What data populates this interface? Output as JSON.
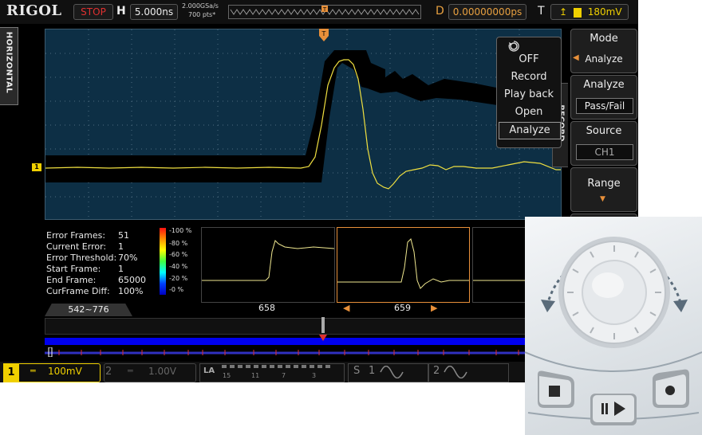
{
  "topbar": {
    "brand": "RIGOL",
    "run_state": "STOP",
    "h_label": "H",
    "timebase": "5.000ns",
    "sample_rate": "2.000GSa/s",
    "memory_depth": "700  pts*",
    "d_label": "D",
    "delay": "0.00000000ps",
    "t_label": "T",
    "trigger_level": "180mV"
  },
  "side_tab": "HORIZONTAL",
  "ch1_marker": "1",
  "record_tab": "RECORD",
  "popup": {
    "items": [
      "OFF",
      "Record",
      "Play back",
      "Open",
      "Analyze"
    ],
    "selected": "Analyze"
  },
  "softkeys": {
    "mode_title": "Mode",
    "mode_value": "Analyze",
    "analyze_title": "Analyze",
    "analyze_value": "Pass/Fail",
    "source_title": "Source",
    "source_value": "CH1",
    "range_title": "Range"
  },
  "stats": [
    {
      "label": "Error Frames:",
      "value": "51"
    },
    {
      "label": "Current Error:",
      "value": "1"
    },
    {
      "label": "Error Threshold:",
      "value": "70%"
    },
    {
      "label": "Start Frame:",
      "value": "1"
    },
    {
      "label": "End Frame:",
      "value": "65000"
    },
    {
      "label": "CurFrame Diff:",
      "value": "100%"
    }
  ],
  "color_scale": [
    "-100 %",
    "-80 %",
    "-60 %",
    "-40 %",
    "-20 %",
    "-0 %"
  ],
  "frames": {
    "left": "658",
    "center": "659"
  },
  "range_tab": "542~776",
  "bottombar": {
    "ch1_num": "1",
    "ch1_scale": "100mV",
    "ch2_num": "2",
    "ch2_scale": "1.00V",
    "la_label": "LA",
    "la_nums": [
      "15",
      "11",
      "7",
      "3"
    ],
    "s_label": "S",
    "s1_num": "1",
    "s2_num": "2"
  },
  "colors": {
    "ch1": "#f0d000",
    "accent": "#e8903a",
    "grid": "#0d2f45",
    "stop": "#e03030"
  }
}
